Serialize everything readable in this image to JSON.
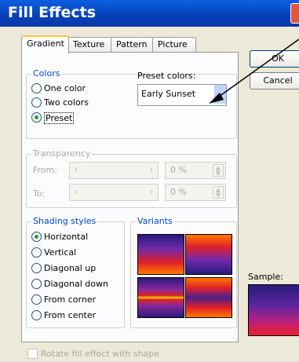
{
  "window": {
    "title": "Fill Effects"
  },
  "tabs": [
    {
      "label": "Gradient"
    },
    {
      "label": "Texture"
    },
    {
      "label": "Pattern"
    },
    {
      "label": "Picture"
    }
  ],
  "colors_group": {
    "title": "Colors",
    "options": [
      "One color",
      "Two colors",
      "Preset"
    ],
    "selected": "Preset",
    "preset_label": "Preset colors:",
    "preset_value": "Early Sunset"
  },
  "transparency": {
    "title": "Transparency",
    "from_label": "From:",
    "to_label": "To:",
    "from_value": "0 %",
    "to_value": "0 %"
  },
  "shading": {
    "title": "Shading styles",
    "options": [
      "Horizontal",
      "Vertical",
      "Diagonal up",
      "Diagonal down",
      "From corner",
      "From center"
    ],
    "selected": "Horizontal"
  },
  "variants": {
    "title": "Variants"
  },
  "buttons": {
    "ok": "OK",
    "cancel": "Cancel"
  },
  "sample": {
    "label": "Sample:"
  },
  "rotate_checkbox": {
    "label": "Rotate fill effect with shape",
    "checked": false
  }
}
